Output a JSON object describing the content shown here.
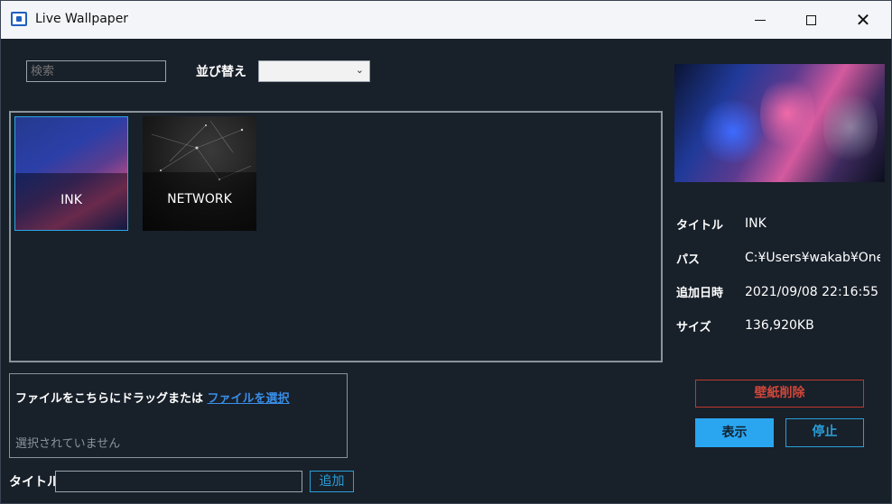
{
  "window": {
    "title": "Live Wallpaper",
    "icons": [
      "app-icon",
      "minimize-icon",
      "maximize-icon",
      "close-icon"
    ]
  },
  "toolbar": {
    "search_placeholder": "検索",
    "sort_label": "並び替え",
    "sort_value": ""
  },
  "gallery": {
    "items": [
      {
        "label": "INK",
        "selected": true
      },
      {
        "label": "NETWORK",
        "selected": false
      }
    ]
  },
  "details": {
    "title_key": "タイトル",
    "title_value": "INK",
    "path_key": "パス",
    "path_value": "C:¥Users¥wakab¥OneD",
    "added_key": "追加日時",
    "added_value": "2021/09/08 22:16:55",
    "size_key": "サイズ",
    "size_value": "136,920KB"
  },
  "dropzone": {
    "text": "ファイルをこちらにドラッグまたは",
    "link": "ファイルを選択",
    "status": "選択されていません"
  },
  "add_form": {
    "title_label": "タイトル",
    "title_value": "",
    "add_label": "追加"
  },
  "actions": {
    "delete_label": "壁紙削除",
    "show_label": "表示",
    "stop_label": "停止"
  },
  "colors": {
    "background": "#18202a",
    "accent": "#2aa6f0",
    "danger": "#d0463a",
    "link": "#3a8ee8"
  }
}
